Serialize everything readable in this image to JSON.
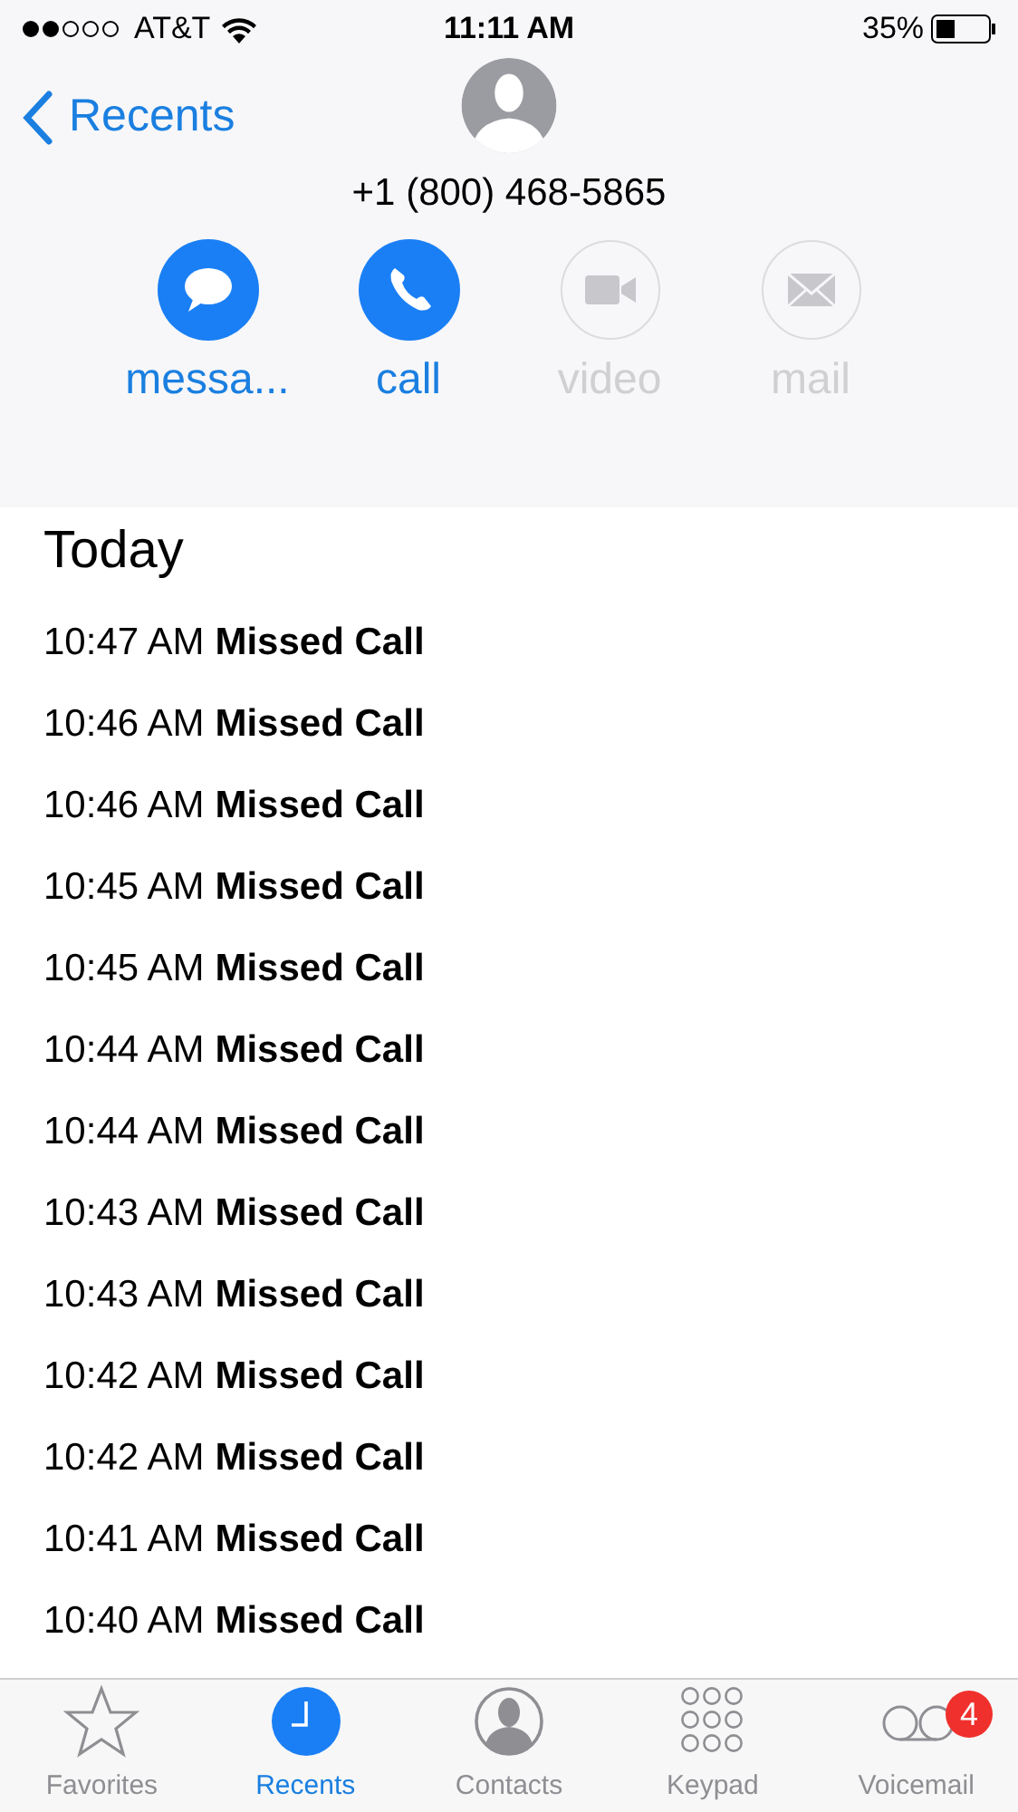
{
  "status_bar": {
    "carrier": "AT&T",
    "time": "11:11 AM",
    "battery": "35%"
  },
  "nav": {
    "back": "Recents"
  },
  "contact": {
    "number": "+1 (800) 468-5865"
  },
  "actions": [
    {
      "kind": "message",
      "label": "messa...",
      "disabled": false
    },
    {
      "kind": "call",
      "label": "call",
      "disabled": false
    },
    {
      "kind": "video",
      "label": "video",
      "disabled": true
    },
    {
      "kind": "mail",
      "label": "mail",
      "disabled": true
    }
  ],
  "section": "Today",
  "calls": [
    {
      "time": "10:47 AM",
      "type": "Missed Call"
    },
    {
      "time": "10:46 AM",
      "type": "Missed Call"
    },
    {
      "time": "10:46 AM",
      "type": "Missed Call"
    },
    {
      "time": "10:45 AM",
      "type": "Missed Call"
    },
    {
      "time": "10:45 AM",
      "type": "Missed Call"
    },
    {
      "time": "10:44 AM",
      "type": "Missed Call"
    },
    {
      "time": "10:44 AM",
      "type": "Missed Call"
    },
    {
      "time": "10:43 AM",
      "type": "Missed Call"
    },
    {
      "time": "10:43 AM",
      "type": "Missed Call"
    },
    {
      "time": "10:42 AM",
      "type": "Missed Call"
    },
    {
      "time": "10:42 AM",
      "type": "Missed Call"
    },
    {
      "time": "10:41 AM",
      "type": "Missed Call"
    },
    {
      "time": "10:40 AM",
      "type": "Missed Call"
    }
  ],
  "tab_bar": [
    {
      "kind": "favorites",
      "label": "Favorites",
      "selected": false
    },
    {
      "kind": "recents",
      "label": "Recents",
      "selected": true
    },
    {
      "kind": "contacts",
      "label": "Contacts",
      "selected": false
    },
    {
      "kind": "keypad",
      "label": "Keypad",
      "selected": false
    },
    {
      "kind": "voicemail",
      "label": "Voicemail",
      "selected": false,
      "badge": "4"
    }
  ]
}
